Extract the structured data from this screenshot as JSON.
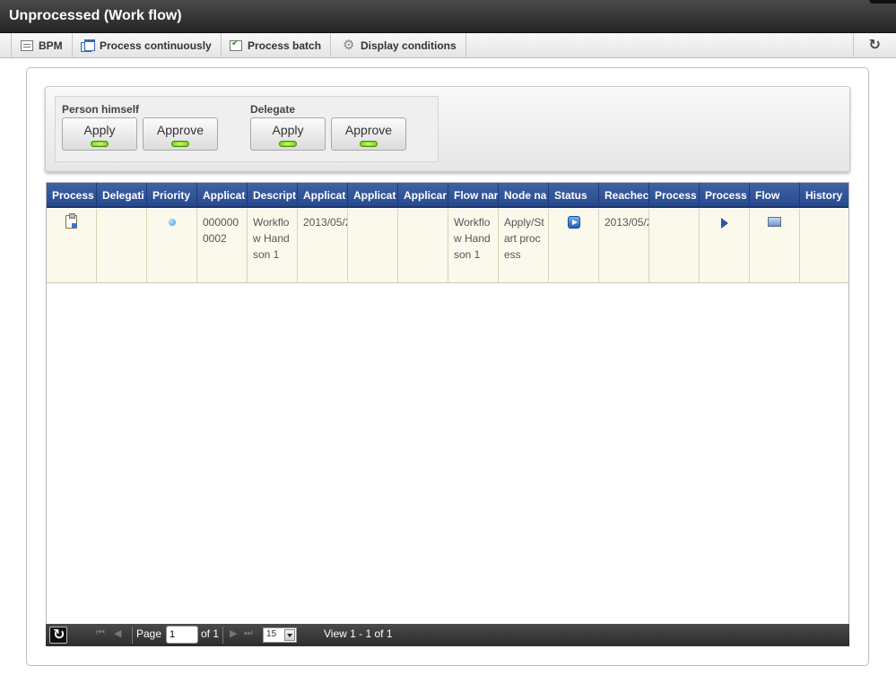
{
  "window": {
    "title": "Unprocessed (Work flow)"
  },
  "toolbar": {
    "items": [
      {
        "label": "BPM",
        "icon": "list-icon"
      },
      {
        "label": "Process continuously",
        "icon": "windows-icon"
      },
      {
        "label": "Process batch",
        "icon": "batch-icon"
      },
      {
        "label": "Display conditions",
        "icon": "gear-icon"
      }
    ],
    "refresh_icon": "refresh-icon"
  },
  "filters": {
    "person": {
      "label": "Person himself",
      "apply": "Apply",
      "approve": "Approve"
    },
    "delegate": {
      "label": "Delegate",
      "apply": "Apply",
      "approve": "Approve"
    }
  },
  "grid": {
    "columns": [
      "Process",
      "Delegati",
      "Priority",
      "Applicat",
      "Descript",
      "Applicat",
      "Applicat",
      "Applicar",
      "Flow nar",
      "Node na",
      "Status",
      "Reachec",
      "Process",
      "Process",
      "Flow",
      "History"
    ],
    "rows": [
      {
        "application_no": "0000000002",
        "description": "Workflow Handson 1",
        "application_date": "2013/05/2",
        "flow_name": "Workflow Handson 1",
        "node_name": "Apply/Start process",
        "reached_date": "2013/05/2"
      }
    ]
  },
  "pager": {
    "page_label": "Page",
    "page_value": "1",
    "of_label": "of 1",
    "rows_per_page": "15",
    "view_text": "View 1 - 1 of 1"
  },
  "colors": {
    "header_bg": "#2f5197",
    "row_bg": "#fbf8ec",
    "led_green": "#7ad400"
  }
}
